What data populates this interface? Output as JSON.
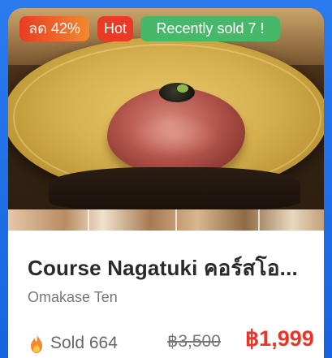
{
  "card": {
    "badges": {
      "discount": "ลด 42%",
      "hot": "Hot",
      "recently_sold": "Recently sold 7 !"
    },
    "title": "Course Nagatuki คอร์สโอ...",
    "restaurant": "Omakase Ten",
    "sold": "Sold 664",
    "original_price": "฿3,500",
    "price": "฿1,999"
  },
  "colors": {
    "accent_frame": "#1f6fe8",
    "price_red": "#e8352a",
    "badge_discount": "#e83c22",
    "badge_hot": "#ea3a26",
    "badge_sold": "#47b86a"
  },
  "icons": {
    "sold": "fire-icon"
  }
}
